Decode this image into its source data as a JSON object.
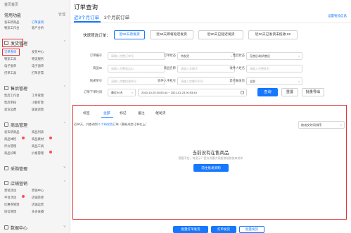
{
  "sidebar": {
    "home": "首页首页",
    "common_title": "常用功能",
    "common_link": "管理",
    "common_items": [
      "发布新商品",
      "订单查询",
      "物流工作台",
      "客户分析"
    ],
    "shipping_title": "发货管理",
    "shipping_items": [
      "订单查询",
      "发货中心",
      "物流工具",
      "物流服务",
      "电子面单",
      "电子面单",
      "打单工具",
      "打单开票"
    ],
    "after_title": "售后管理",
    "after_items": [
      "售后工作台",
      "工单管理",
      "售后审核",
      "小额打款",
      "退货运费",
      "极速退款"
    ],
    "goods_title": "商品管理",
    "goods_items": [
      "发布新商品",
      "商品列表",
      "商品体检",
      "商品素材",
      "评价管理",
      "商品工具",
      "商品诊断",
      "价格管理"
    ],
    "purchase_title": "采购管理",
    "shop_title": "店铺营销",
    "shop_items": [
      "营销活动",
      "营销中心",
      "平台活动",
      "店铺装修",
      "优惠券管理",
      "店铺运营",
      "短信管理",
      "多多直播"
    ],
    "data_title": "数据中心"
  },
  "main": {
    "title": "订单查询",
    "tabs": [
      "近3个月订单",
      "3个月前订单"
    ],
    "top_right": "设置物流信息",
    "quick_label": "快速筛选订单：",
    "quick_filters": [
      "近90天待发货",
      "近90天即将延迟发货",
      "近90天已延迟发货",
      "近30天已发货未揽收 62"
    ],
    "filters": {
      "order_no": {
        "label": "订单编号",
        "placeholder": "请输入完整订单号"
      },
      "order_status": {
        "label": "订单状态",
        "value": "待发货"
      },
      "after_status": {
        "label": "售后状态",
        "value": "无售后/取消售后"
      },
      "goods_id": {
        "label": "商品ID",
        "placeholder": "请输入完整商品ID"
      },
      "goods_name": {
        "label": "商品名称",
        "placeholder": "请输入关键字"
      },
      "receiver": {
        "label": "收件人姓名",
        "placeholder": "请输入完整姓名"
      },
      "tracking": {
        "label": "快递单号",
        "placeholder": "请输入完整快递单号"
      },
      "phone": {
        "label": "收件人手机号",
        "placeholder": "请输入完整手机号"
      },
      "type": {
        "label": "是否催发货",
        "value": "全部"
      },
      "time": {
        "label": "订单下单时间",
        "range": "最近90天",
        "value": "2020-10-25 00:53:44 ~ 2021-01-23 00:53:44"
      }
    },
    "buttons": {
      "query": "查询",
      "reset": "重置",
      "export": "批量导出"
    },
    "status_tabs": [
      "标签",
      "全部",
      "标记",
      "备注",
      "催发货"
    ],
    "notice": "近90天，共查询到 0 个待发货订单（最新成交订单在上）",
    "notice_link": "0 个待发货",
    "sort": "按成交时间排序",
    "empty_title": "当前没有在售商品",
    "empty_sub": "您暂不在，待显示？官方优惠大家赶快给快快来发布",
    "empty_btn": "前往批发采购",
    "bottom_buttons": [
      "批量打单发货",
      "打单发货",
      "批量发货"
    ]
  },
  "colors": {
    "accent": "#1677ff",
    "highlight": "#e03333"
  }
}
